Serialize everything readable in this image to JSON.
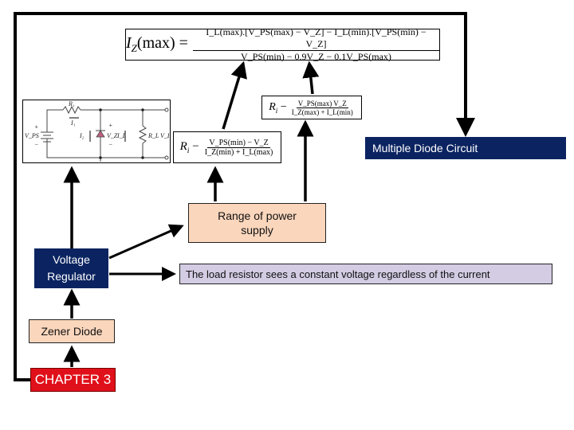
{
  "formulas": {
    "iz_max": {
      "lhs": "I",
      "lhs_sub": "Z",
      "lhs_rest": "(max) =",
      "numerator": "I_L(max).[V_PS(max) − V_Z] − I_L(min).[V_PS(min) − V_Z]",
      "denominator": "V_PS(min) − 0.9V_Z − 0.1V_PS(max)"
    },
    "ri_upper": {
      "lhs": "R",
      "lhs_sub": "i",
      "eq": "−",
      "numerator": "V_PS(max)   V_Z",
      "denominator": "I_Z(max) + I_L(min)"
    },
    "ri_lower": {
      "lhs": "R",
      "lhs_sub": "i",
      "eq": "−",
      "numerator": "V_PS(min) − V_Z",
      "denominator": "I_Z(min) + I_L(max)"
    }
  },
  "circuit": {
    "labels": {
      "r1": "R₁",
      "i1": "I₁",
      "vps": "V_PS",
      "i2": "I₂",
      "vz": "V_Z",
      "il": "I_L",
      "rl": "R_L",
      "vl": "V_L",
      "plus": "+",
      "minus": "−"
    }
  },
  "nodes": {
    "multiple_diode": "Multiple Diode Circuit",
    "range_power": "Range of power supply",
    "load_resistor": "The load resistor sees a constant voltage regardless of the current",
    "voltage_regulator": "Voltage Regulator",
    "zener_diode": "Zener Diode",
    "chapter": "CHAPTER 3"
  },
  "colors": {
    "navy": "#0b2461",
    "peach": "#fad6bc",
    "lavender": "#d3cce3",
    "red": "#e0101a"
  }
}
